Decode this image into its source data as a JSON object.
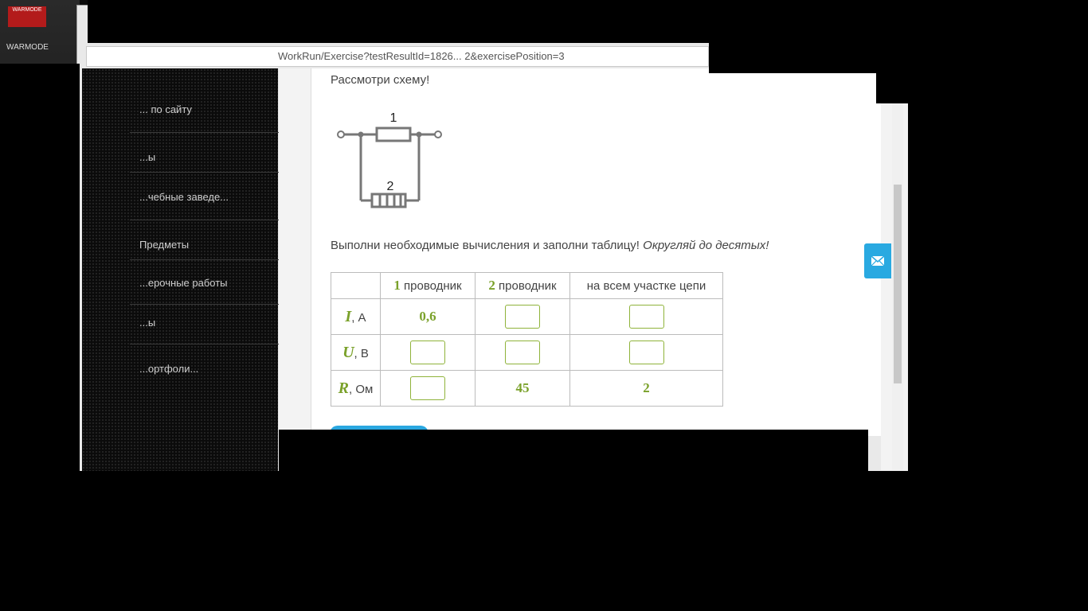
{
  "desktop": {
    "shortcut_label": "WARMODE"
  },
  "browser": {
    "url_fragment": "WorkRun/Exercise?testResultId=1826... 2&exercisePosition=3"
  },
  "sidebar": {
    "items": [
      {
        "label": "... по сайту"
      },
      {
        "label": "...ы"
      },
      {
        "label": "...чебные заведе..."
      },
      {
        "label": "Предметы"
      },
      {
        "label": "...ерочные работы"
      },
      {
        "label": "...ы"
      },
      {
        "label": "...ортфоли..."
      }
    ]
  },
  "exercise": {
    "prompt": "Рассмотри схему!",
    "diagram": {
      "label_1": "1",
      "label_2": "2"
    },
    "instruction": "Выполни необходимые вычисления и заполни таблицу!",
    "instruction_hint": "Округляй до десятых!",
    "table": {
      "headers": {
        "col1_num": "1",
        "col1_text": " проводник",
        "col2_num": "2",
        "col2_text": " проводник",
        "col3": "на всем участке цепи"
      },
      "rows": [
        {
          "symbol": "I",
          "unit": ", А",
          "c1": "0,6",
          "c2": "",
          "c3": ""
        },
        {
          "symbol": "U",
          "unit": ", В",
          "c1": "",
          "c2": "",
          "c3": ""
        },
        {
          "symbol": "R",
          "unit": ", Ом",
          "c1": "",
          "c2": "45",
          "c3": "2"
        }
      ]
    }
  },
  "colors": {
    "accent_green": "#7aa12a",
    "accent_blue": "#29a9e1"
  },
  "icons": {
    "feedback": "mail-icon"
  }
}
